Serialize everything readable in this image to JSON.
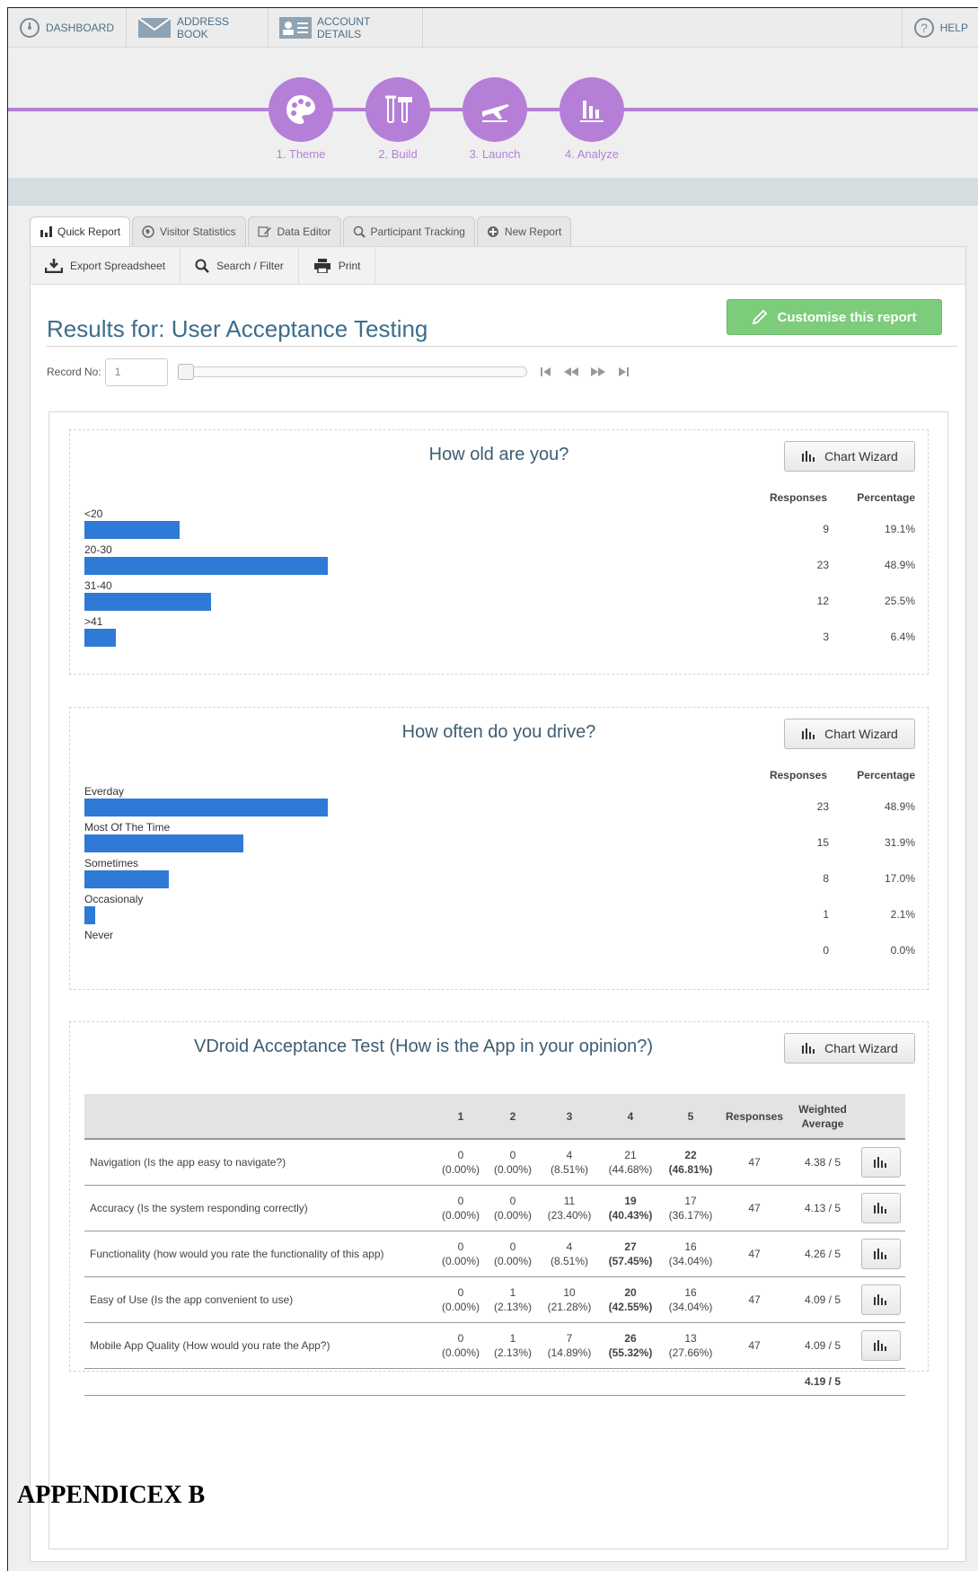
{
  "nav": {
    "dashboard": "DASHBOARD",
    "address_book": "ADDRESS BOOK",
    "account_details": "ACCOUNT DETAILS",
    "help": "HELP"
  },
  "steps": [
    {
      "label": "1. Theme",
      "icon": "palette-icon"
    },
    {
      "label": "2. Build",
      "icon": "tools-icon"
    },
    {
      "label": "3. Launch",
      "icon": "plane-icon"
    },
    {
      "label": "4. Analyze",
      "icon": "bar-chart-icon"
    }
  ],
  "colors": {
    "accent": "#b57fd8",
    "bar": "#2f7ad6",
    "title": "#3c6d8c",
    "button_green": "#7ccc7c"
  },
  "tabs": [
    "Quick Report",
    "Visitor Statistics",
    "Data Editor",
    "Participant Tracking",
    "New Report"
  ],
  "toolbar": {
    "export": "Export Spreadsheet",
    "search": "Search / Filter",
    "print": "Print"
  },
  "report": {
    "title": "Results for: User Acceptance Testing",
    "customise": "Customise this report",
    "record_label": "Record No:",
    "record_value": "1"
  },
  "chart_wizard": "Chart Wizard",
  "col_responses": "Responses",
  "col_percentage": "Percentage",
  "q1": {
    "title": "How old are you?",
    "rows": [
      {
        "label": "<20",
        "responses": "9",
        "pct": "19.1%"
      },
      {
        "label": "20-30",
        "responses": "23",
        "pct": "48.9%"
      },
      {
        "label": "31-40",
        "responses": "12",
        "pct": "25.5%"
      },
      {
        "label": ">41",
        "responses": "3",
        "pct": "6.4%"
      }
    ]
  },
  "q2": {
    "title": "How often do you drive?",
    "rows": [
      {
        "label": "Everday",
        "responses": "23",
        "pct": "48.9%"
      },
      {
        "label": "Most Of The Time",
        "responses": "15",
        "pct": "31.9%"
      },
      {
        "label": "Sometimes",
        "responses": "8",
        "pct": "17.0%"
      },
      {
        "label": "Occasionaly",
        "responses": "1",
        "pct": "2.1%"
      },
      {
        "label": "Never",
        "responses": "0",
        "pct": "0.0%"
      }
    ]
  },
  "q3": {
    "title": "VDroid Acceptance Test (How is the App in your opinion?)",
    "headers": [
      "1",
      "2",
      "3",
      "4",
      "5",
      "Responses",
      "Weighted Average"
    ],
    "rows": [
      {
        "q": "Navigation (Is the app easy to navigate?)",
        "c": [
          [
            "0",
            "(0.00%)"
          ],
          [
            "0",
            "(0.00%)"
          ],
          [
            "4",
            "(8.51%)"
          ],
          [
            "21",
            "(44.68%)"
          ],
          [
            "22",
            "(46.81%)"
          ]
        ],
        "bold": 4,
        "responses": "47",
        "avg": "4.38 / 5"
      },
      {
        "q": "Accuracy (Is the system responding correctly)",
        "c": [
          [
            "0",
            "(0.00%)"
          ],
          [
            "0",
            "(0.00%)"
          ],
          [
            "11",
            "(23.40%)"
          ],
          [
            "19",
            "(40.43%)"
          ],
          [
            "17",
            "(36.17%)"
          ]
        ],
        "bold": 3,
        "responses": "47",
        "avg": "4.13 / 5"
      },
      {
        "q": "Functionality (how would you rate the functionality of this app)",
        "c": [
          [
            "0",
            "(0.00%)"
          ],
          [
            "0",
            "(0.00%)"
          ],
          [
            "4",
            "(8.51%)"
          ],
          [
            "27",
            "(57.45%)"
          ],
          [
            "16",
            "(34.04%)"
          ]
        ],
        "bold": 3,
        "responses": "47",
        "avg": "4.26 / 5"
      },
      {
        "q": "Easy of Use (Is the app convenient to use)",
        "c": [
          [
            "0",
            "(0.00%)"
          ],
          [
            "1",
            "(2.13%)"
          ],
          [
            "10",
            "(21.28%)"
          ],
          [
            "20",
            "(42.55%)"
          ],
          [
            "16",
            "(34.04%)"
          ]
        ],
        "bold": 3,
        "responses": "47",
        "avg": "4.09 / 5"
      },
      {
        "q": "Mobile App Quality (How would you rate the App?)",
        "c": [
          [
            "0",
            "(0.00%)"
          ],
          [
            "1",
            "(2.13%)"
          ],
          [
            "7",
            "(14.89%)"
          ],
          [
            "26",
            "(55.32%)"
          ],
          [
            "13",
            "(27.66%)"
          ]
        ],
        "bold": 3,
        "responses": "47",
        "avg": "4.09 / 5"
      }
    ],
    "total_avg": "4.19 / 5"
  },
  "appendix": "APPENDICEX B"
}
